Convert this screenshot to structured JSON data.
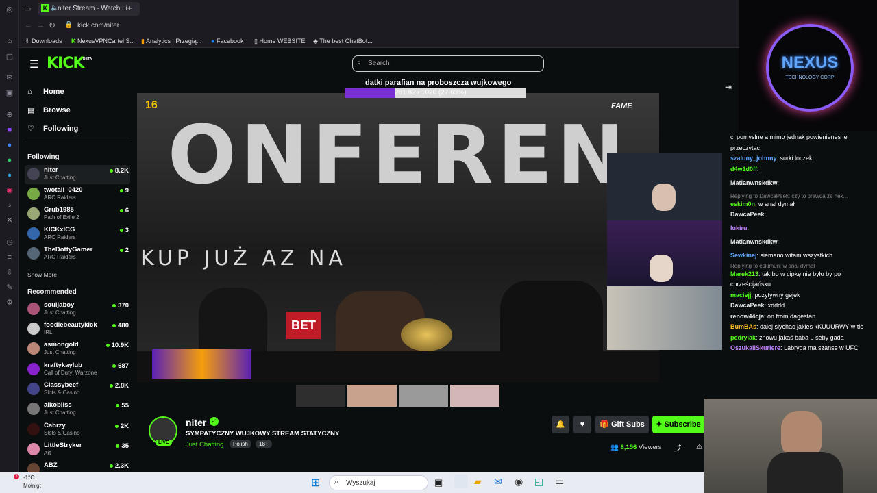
{
  "browser": {
    "tab_title": "niter Stream - Watch Li",
    "url": "kick.com/niter",
    "bookmarks": [
      "Downloads",
      "NexusVPNCartel S...",
      "Analytics | Przegią...",
      "Facebook",
      "Home WEBSITE",
      "The best ChatBot..."
    ]
  },
  "kick": {
    "logo": "KICK",
    "beta": "BETA",
    "search_placeholder": "Search",
    "nav": [
      {
        "label": "Home"
      },
      {
        "label": "Browse"
      },
      {
        "label": "Following"
      }
    ],
    "following_title": "Following",
    "following": [
      {
        "name": "niter",
        "category": "Just Chatting",
        "viewers": "8.2K"
      },
      {
        "name": "twotall_0420",
        "category": "ARC Raiders",
        "viewers": "9"
      },
      {
        "name": "Grub1985",
        "category": "Path of Exile 2",
        "viewers": "6"
      },
      {
        "name": "KICKxICG",
        "category": "ARC Raiders",
        "viewers": "3"
      },
      {
        "name": "TheDottyGamer",
        "category": "ARC Raiders",
        "viewers": "2"
      }
    ],
    "show_more": "Show More",
    "recommended_title": "Recommended",
    "recommended": [
      {
        "name": "souljaboy",
        "category": "Just Chatting",
        "viewers": "370"
      },
      {
        "name": "foodiebeautykick",
        "category": "IRL",
        "viewers": "480"
      },
      {
        "name": "asmongold",
        "category": "Just Chatting",
        "viewers": "10.9K"
      },
      {
        "name": "kraftykaylub",
        "category": "Call of Duty: Warzone",
        "viewers": "687"
      },
      {
        "name": "Classybeef",
        "category": "Slots & Casino",
        "viewers": "2.8K"
      },
      {
        "name": "aikobliss",
        "category": "Just Chatting",
        "viewers": "55"
      },
      {
        "name": "Cabrzy",
        "category": "Slots & Casino",
        "viewers": "2K"
      },
      {
        "name": "LittleStryker",
        "category": "Art",
        "viewers": "35"
      },
      {
        "name": "ABZ",
        "category": "",
        "viewers": "2.3K"
      }
    ]
  },
  "video": {
    "goal_title": "datki parafian na proboszcza wujkowego",
    "goal_progress": "281.82 / 1020 (27.63%)",
    "goal_fraction": 0.2763,
    "overlay_big": "ONFEREN",
    "overlay_line": "KUP   JUŻ    AZ NA",
    "age_badge": "16",
    "fame_tag": "FAME"
  },
  "stream": {
    "channel": "niter",
    "live": "LIVE",
    "title": "SYMPATYCZNY WUJKOWY STREAM STATYCZNY",
    "category": "Just Chatting",
    "tags": [
      "Polish",
      "18+"
    ],
    "gift_label": "Gift Subs",
    "subscribe_label": "Subscribe",
    "viewers": "8,156",
    "viewers_label": "Viewers"
  },
  "chat": [
    {
      "type": "text",
      "text": "ci pomyslne a mimo jednak powienienes je"
    },
    {
      "type": "text",
      "text": "przeczytac"
    },
    {
      "user": "szalony_johnny",
      "color": "#60a5fa",
      "text": "sorki loczek"
    },
    {
      "user": "d4w1d0ff",
      "color": "#53fc18",
      "text": ""
    },
    {
      "user": "Matlanwnskdkw",
      "color": "#e5e7eb",
      "text": ""
    },
    {
      "type": "reply",
      "text": "Replying to DawcaPeek: czy to prawda że nex..."
    },
    {
      "user": "eskim0n",
      "color": "#53fc18",
      "text": "w anal dymał"
    },
    {
      "user": "DawcaPeek",
      "color": "#e5e7eb",
      "text": ""
    },
    {
      "user": "lukiru",
      "color": "#c084fc",
      "text": ""
    },
    {
      "user": "Matlanwnskdkw",
      "color": "#e5e7eb",
      "text": ""
    },
    {
      "user": "Sewkinej",
      "color": "#60a5fa",
      "text": "siemano witam wszystkich"
    },
    {
      "type": "reply",
      "text": "Replying to eskim0n: w anal dymał"
    },
    {
      "user": "Marek213",
      "color": "#53fc18",
      "text": "tak bo w cipkę nie było by po"
    },
    {
      "type": "text",
      "text": "chrześcijańsku"
    },
    {
      "user": "maciejj",
      "color": "#53fc18",
      "text": "pozytywny gejek"
    },
    {
      "user": "DawcaPeek",
      "color": "#e5e7eb",
      "text": "xdddd"
    },
    {
      "user": "renow44cja",
      "color": "#e5e7eb",
      "text": "on from dagestan"
    },
    {
      "user": "BumBAs",
      "color": "#fbbf24",
      "text": "dalej slychac jakies kKUUURWY w tle"
    },
    {
      "user": "pedrylak",
      "color": "#53fc18",
      "text": "znowu jakaś baba u seby gada"
    },
    {
      "user": "OszukaliSkuriere",
      "color": "#c084fc",
      "text": "Labryga ma szanse w UFC"
    }
  ],
  "nexus": {
    "title": "NEXUS",
    "subtitle": "TECHNOLOGY CORP"
  },
  "taskbar": {
    "weather_temp": "-1°C",
    "weather_desc": "Mołnigt",
    "search_placeholder": "Wyszukaj",
    "badge": "1"
  }
}
